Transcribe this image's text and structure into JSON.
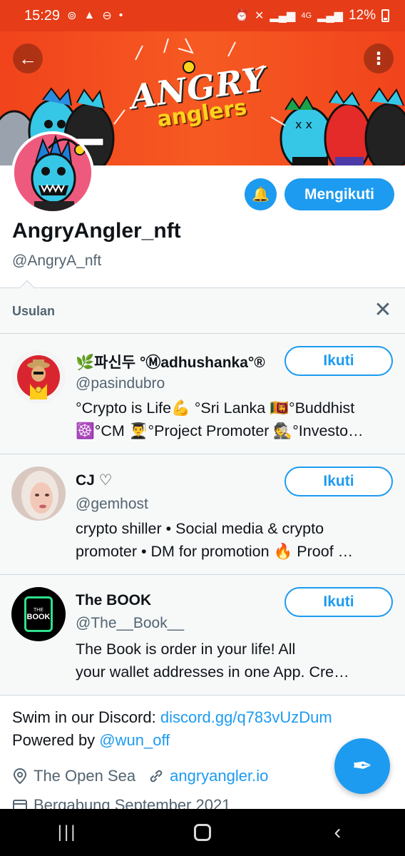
{
  "status_bar": {
    "time": "15:29",
    "network": "4G",
    "battery": "12%"
  },
  "banner": {
    "title_line1": "ANGRY",
    "title_line2": "anglers"
  },
  "profile": {
    "display_name": "AngryAngler_nft",
    "handle": "@AngryA_nft",
    "following_label": "Mengikuti"
  },
  "suggestions": {
    "title": "Usulan",
    "items": [
      {
        "name": "🌿파신두 °Ⓜadhushanka°®",
        "handle": "@pasindubro",
        "bio_line1": "°Crypto is Life💪 °Sri Lanka 🇱🇰°Buddhist",
        "bio_line2": "☸️°CM 👨‍🎓°Project Promoter 🕵️°Investo…",
        "follow_label": "Ikuti"
      },
      {
        "name": "CJ ♡",
        "handle": "@gemhost",
        "bio_line1": "crypto shiller • Social media & crypto",
        "bio_line2": "promoter • DM for promotion 🔥 Proof …",
        "follow_label": "Ikuti"
      },
      {
        "name": "The BOOK",
        "handle": "@The__Book__",
        "bio_line1": "The Book is order in your life! All",
        "bio_line2": "your wallet addresses in one App.   Cre…",
        "follow_label": "Ikuti",
        "avatar_text_small": "THE",
        "avatar_text": "BOOK"
      }
    ]
  },
  "bio": {
    "line1_prefix": "Swim in our Discord: ",
    "line1_link": "discord.gg/q783vUzDum",
    "line2_prefix": "Powered by ",
    "line2_link": "@wun_off",
    "location": "The Open Sea",
    "website": "angryangler.io",
    "joined": "Bergabung September 2021"
  },
  "colors": {
    "accent": "#1d9bf0",
    "status_bar": "#e63c17",
    "banner": "#f65a22"
  }
}
